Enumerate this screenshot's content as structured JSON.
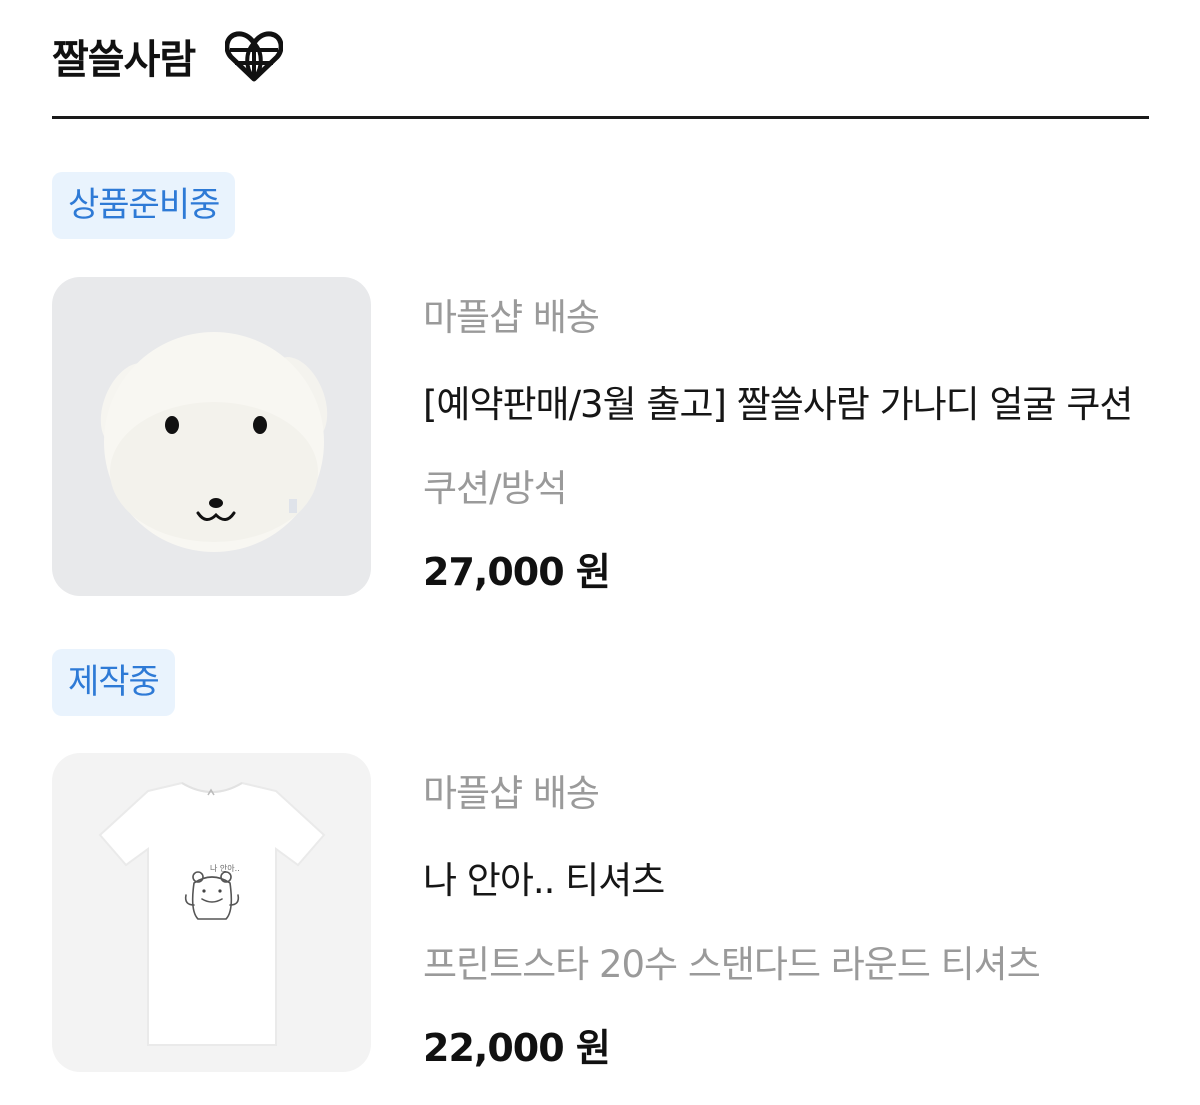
{
  "header": {
    "shop_name": "짤쓸사람",
    "icon": "heart-globe-icon"
  },
  "products": [
    {
      "status_badge": "상품준비중",
      "shipping": "마플샵 배송",
      "name": "[예약판매/3월 출고] 짤쓸사람 가나디 얼굴 쿠션",
      "category": "쿠션/방석",
      "price": "27,000 원",
      "image_icon": "dog-face-cushion-image"
    },
    {
      "status_badge": "제작중",
      "shipping": "마플샵 배송",
      "name": "나 안아.. 티셔츠",
      "category": "프린트스타 20수 스탠다드 라운드 티셔츠",
      "price": "22,000 원",
      "image_icon": "tshirt-image"
    }
  ],
  "colors": {
    "badge_bg": "#e9f3fd",
    "badge_text": "#2e7ad6",
    "muted_text": "#9a9a9a"
  }
}
